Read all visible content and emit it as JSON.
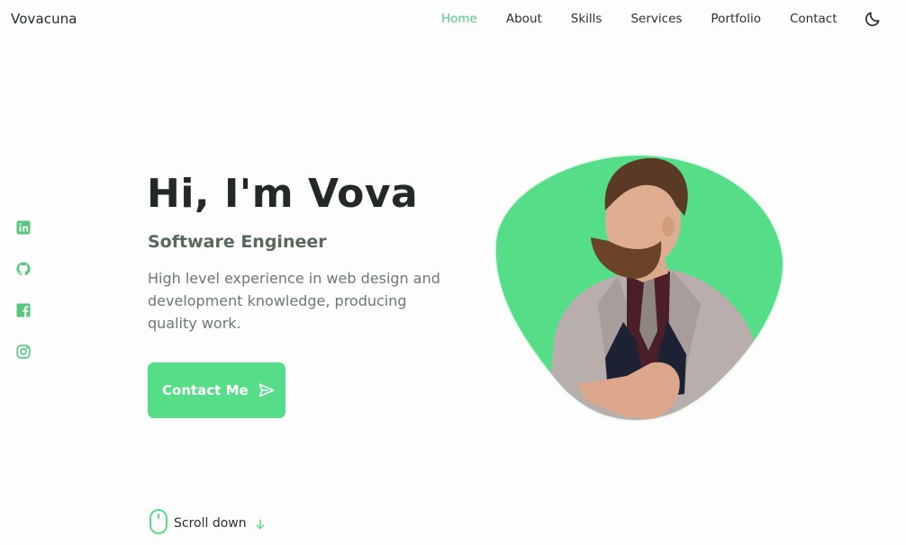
{
  "header": {
    "logo": "Vovacuna",
    "nav": [
      {
        "label": "Home",
        "active": true
      },
      {
        "label": "About",
        "active": false
      },
      {
        "label": "Skills",
        "active": false
      },
      {
        "label": "Services",
        "active": false
      },
      {
        "label": "Portfolio",
        "active": false
      },
      {
        "label": "Contact",
        "active": false
      }
    ],
    "theme_toggle_icon": "moon-icon"
  },
  "social": [
    {
      "icon": "linkedin-icon"
    },
    {
      "icon": "github-icon"
    },
    {
      "icon": "facebook-icon"
    },
    {
      "icon": "instagram-icon"
    }
  ],
  "hero": {
    "title": "Hi, I'm Vova",
    "subtitle": "Software Engineer",
    "description": "High level experience in web design and development knowledge, producing quality work.",
    "cta_label": "Contact Me",
    "cta_icon": "send-icon"
  },
  "scroll": {
    "label": "Scroll down",
    "icon": "mouse-icon",
    "arrow_icon": "arrow-down-icon"
  },
  "colors": {
    "accent": "#56dd88",
    "nav_active": "#56c77c",
    "title": "#232a25",
    "subtitle": "#56695c",
    "text": "#6b7a70",
    "background": "#fdfdfd"
  }
}
